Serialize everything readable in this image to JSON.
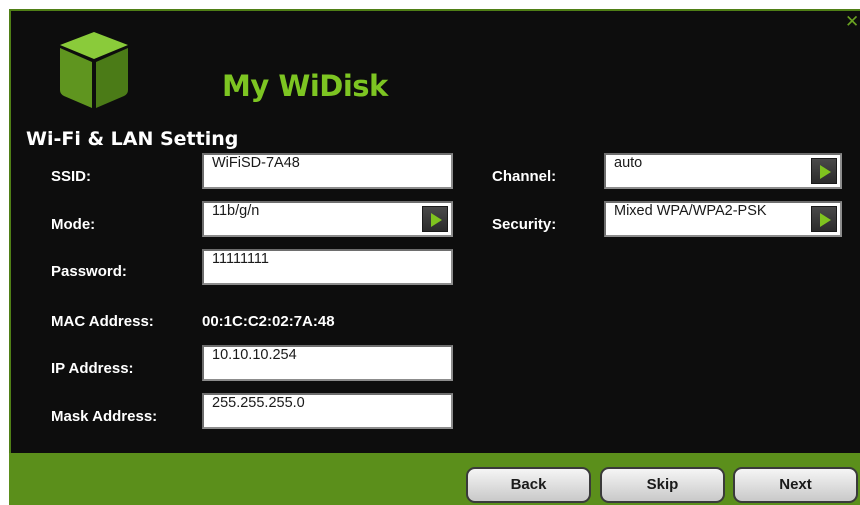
{
  "app": {
    "title": "My WiDisk"
  },
  "section": {
    "title": "Wi-Fi & LAN Setting"
  },
  "form": {
    "ssid": {
      "label": "SSID:",
      "value": "WiFiSD-7A48"
    },
    "mode": {
      "label": "Mode:",
      "value": "11b/g/n"
    },
    "password": {
      "label": "Password:",
      "value": "11111111"
    },
    "mac": {
      "label": "MAC Address:",
      "value": "00:1C:C2:02:7A:48"
    },
    "ip": {
      "label": "IP Address:",
      "value": "10.10.10.254"
    },
    "mask": {
      "label": "Mask Address:",
      "value": "255.255.255.0"
    },
    "channel": {
      "label": "Channel:",
      "value": "auto"
    },
    "security": {
      "label": "Security:",
      "value": "Mixed WPA/WPA2-PSK"
    }
  },
  "buttons": {
    "back": "Back",
    "skip": "Skip",
    "next": "Next"
  },
  "icons": {
    "close": "close-icon",
    "logo": "cube-logo-icon",
    "dropdown": "play-arrow-icon"
  },
  "colors": {
    "brand_green": "#7dc522",
    "footer_green": "#5b8f1b",
    "background": "#0d0d0d"
  }
}
